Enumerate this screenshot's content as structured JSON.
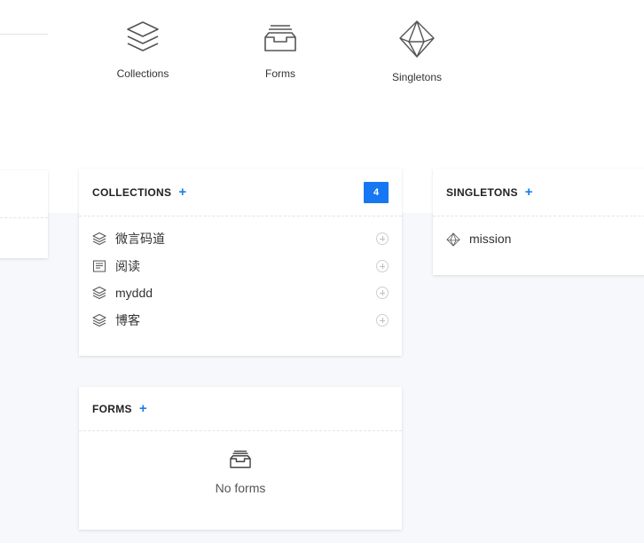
{
  "quick_actions": [
    {
      "label": "Collections",
      "icon": "layers-icon"
    },
    {
      "label": "Forms",
      "icon": "inbox-icon"
    },
    {
      "label": "Singletons",
      "icon": "octahedron-icon"
    }
  ],
  "collections": {
    "title": "COLLECTIONS",
    "add_label": "+",
    "count": "4",
    "items": [
      {
        "name": "微言码道",
        "icon": "layers-icon"
      },
      {
        "name": "阅读",
        "icon": "list-doc-icon"
      },
      {
        "name": "myddd",
        "icon": "layers-icon"
      },
      {
        "name": "博客",
        "icon": "layers-icon"
      }
    ]
  },
  "singletons": {
    "title": "SINGLETONS",
    "add_label": "+",
    "items": [
      {
        "name": "mission",
        "icon": "octahedron-icon"
      }
    ]
  },
  "forms": {
    "title": "FORMS",
    "add_label": "+",
    "empty_text": "No forms",
    "empty_icon": "inbox-icon"
  },
  "colors": {
    "accent": "#1677f2",
    "plus": "#1a7ee8",
    "background": "#f6f8fb"
  }
}
